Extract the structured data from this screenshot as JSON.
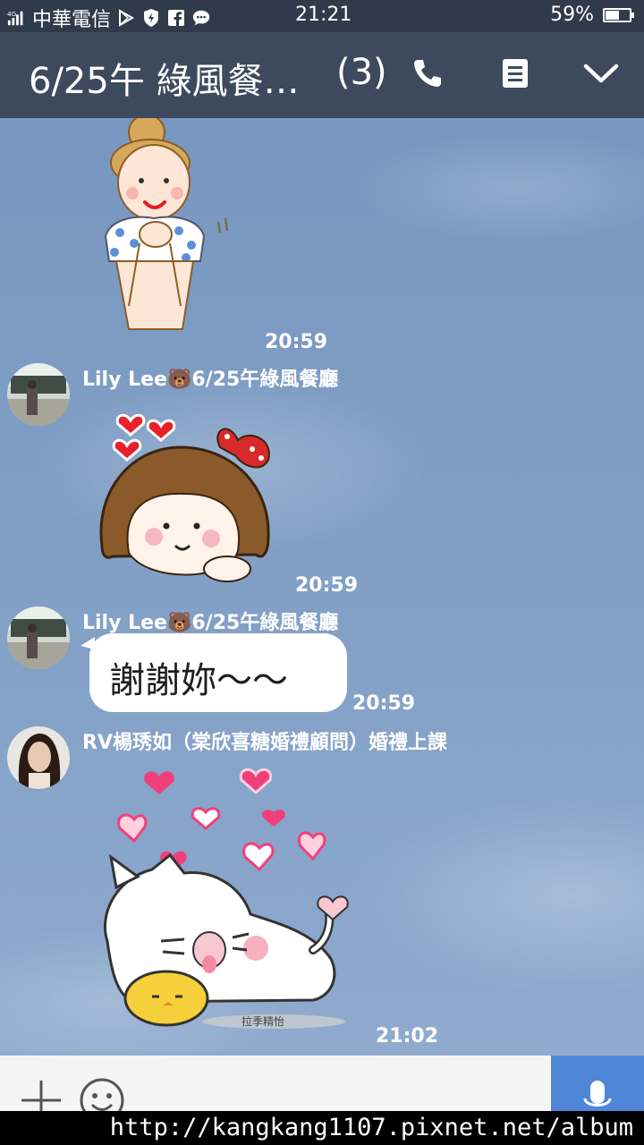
{
  "status_bar": {
    "network": "4G",
    "carrier": "中華電信",
    "time": "21:21",
    "battery_text": "59%",
    "battery_level": 0.59,
    "icons": [
      "signal-icon",
      "play-store-icon",
      "shield-bolt-icon",
      "facebook-icon",
      "chat-bubble-icon",
      "battery-icon"
    ]
  },
  "header": {
    "title": "6/25午 綠風餐…",
    "member_count": "(3)",
    "icons": [
      "phone-icon",
      "notes-icon",
      "chevron-down-icon"
    ]
  },
  "messages": [
    {
      "type": "sticker",
      "sticker": "girl-with-bun-sticker",
      "time": "20:59"
    },
    {
      "type": "sticker",
      "sender": "Lily Lee🐻6/25午綠風餐廳",
      "sticker": "girl-with-hearts-sticker",
      "time": "20:59"
    },
    {
      "type": "text",
      "sender": "Lily Lee🐻6/25午綠風餐廳",
      "text": "謝謝妳～～",
      "time": "20:59"
    },
    {
      "type": "sticker",
      "sender": "RV楊琇如（棠欣喜糖婚禮顧問）婚禮上課",
      "sticker": "cat-with-hearts-sticker",
      "sticker_caption": "拉季精怡",
      "time": "21:02"
    }
  ],
  "input_bar": {
    "icons": [
      "plus-icon",
      "emoji-icon",
      "microphone-icon"
    ]
  },
  "watermark": "http://kangkang1107.pixnet.net/album",
  "colors": {
    "status_bar_bg": "#2f3a4a",
    "header_bg": "#3d4a5e",
    "chat_bg": "#7d9cc4",
    "mic_button": "#4f86d8",
    "bubble": "#ffffff"
  }
}
